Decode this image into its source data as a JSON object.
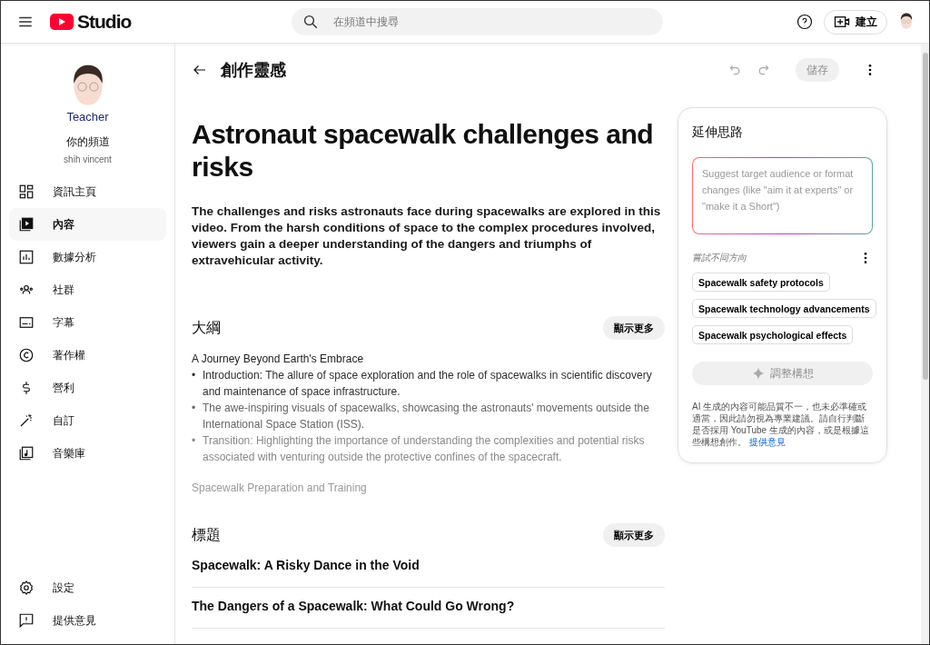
{
  "header": {
    "logo": "Studio",
    "search": {
      "placeholder": "在頻道中搜尋"
    },
    "create_button": "建立"
  },
  "sidebar": {
    "avatar_caption": "Teacher",
    "channel_label": "你的頻道",
    "channel_name": "shih vincent",
    "items": [
      {
        "label": "資訊主頁",
        "selected": false
      },
      {
        "label": "內容",
        "selected": true
      },
      {
        "label": "數據分析",
        "selected": false
      },
      {
        "label": "社群",
        "selected": false
      },
      {
        "label": "字幕",
        "selected": false
      },
      {
        "label": "著作權",
        "selected": false
      },
      {
        "label": "營利",
        "selected": false
      },
      {
        "label": "自訂",
        "selected": false
      },
      {
        "label": "音樂庫",
        "selected": false
      }
    ],
    "bottom_items": [
      {
        "label": "設定",
        "selected": false
      },
      {
        "label": "提供意見",
        "selected": false
      }
    ]
  },
  "page": {
    "title": "創作靈感",
    "save_button": {
      "label": "儲存",
      "disabled": true
    }
  },
  "idea": {
    "title": "Astronaut spacewalk challenges and risks",
    "description": "The challenges and risks astronauts face during spacewalks are explored in this video. From the harsh conditions of space to the complex procedures involved, viewers gain a deeper understanding of the dangers and triumphs of extravehicular activity.",
    "outline": {
      "heading": "大綱",
      "show_more": "顯示更多",
      "section_title": "A Journey Beyond Earth's Embrace",
      "marker": "•",
      "bullets": [
        "Introduction: The allure of space exploration and the role of spacewalks in scientific discovery and maintenance of space infrastructure.",
        "The awe-inspiring visuals of spacewalks, showcasing the astronauts' movements outside the International Space Station (ISS).",
        "Transition: Highlighting the importance of understanding the complexities and potential risks associated with venturing outside the protective confines of the spacecraft."
      ],
      "next_section_title": "Spacewalk Preparation and Training"
    },
    "titles": {
      "heading": "標題",
      "show_more": "顯示更多",
      "items": [
        "Spacewalk: A Risky Dance in the Void",
        "The Dangers of a Spacewalk: What Could Go Wrong?"
      ]
    }
  },
  "panel": {
    "title": "延伸思路",
    "prompt": {
      "placeholder": "Suggest target audience or format changes (like \"aim it at experts\" or \"make it a Short\")"
    },
    "directions_label": "嘗試不同方向",
    "chips": [
      "Spacewalk safety protocols",
      "Spacewalk technology advancements",
      "Spacewalk psychological effects"
    ],
    "refine_button": {
      "label": "調整構想",
      "disabled": true
    },
    "disclaimer": "AI 生成的內容可能品質不一，也未必準確或適當，因此請勿視為專業建議。請自行判斷是否採用 YouTube 生成的內容，或是根據這些構想創作。",
    "feedback_link": "提供意見"
  }
}
